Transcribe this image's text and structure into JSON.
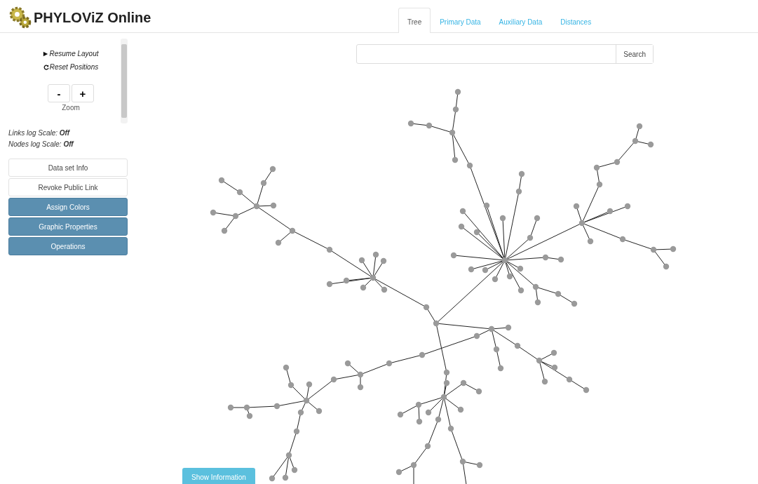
{
  "header": {
    "title": "PHYLOViZ Online"
  },
  "tabs": [
    {
      "label": "Tree",
      "selected": true
    },
    {
      "label": "Primary Data",
      "selected": false
    },
    {
      "label": "Auxiliary Data",
      "selected": false
    },
    {
      "label": "Distances",
      "selected": false
    }
  ],
  "search": {
    "button": "Search"
  },
  "sidebar": {
    "resume": "Resume Layout",
    "reset": "Reset Positions",
    "zoom_out": "-",
    "zoom_in": "+",
    "zoom_label": "Zoom",
    "scales": [
      {
        "label": "Links log Scale: ",
        "value": "Off"
      },
      {
        "label": "Nodes log Scale: ",
        "value": "Off"
      }
    ],
    "buttons": [
      {
        "label": "Data set Info",
        "kind": "plain"
      },
      {
        "label": "Revoke Public Link",
        "kind": "plain"
      },
      {
        "label": "Assign Colors",
        "kind": "primary"
      },
      {
        "label": "Graphic Properties",
        "kind": "primary"
      },
      {
        "label": "Operations",
        "kind": "primary"
      }
    ]
  },
  "info_button": "Show Information"
}
